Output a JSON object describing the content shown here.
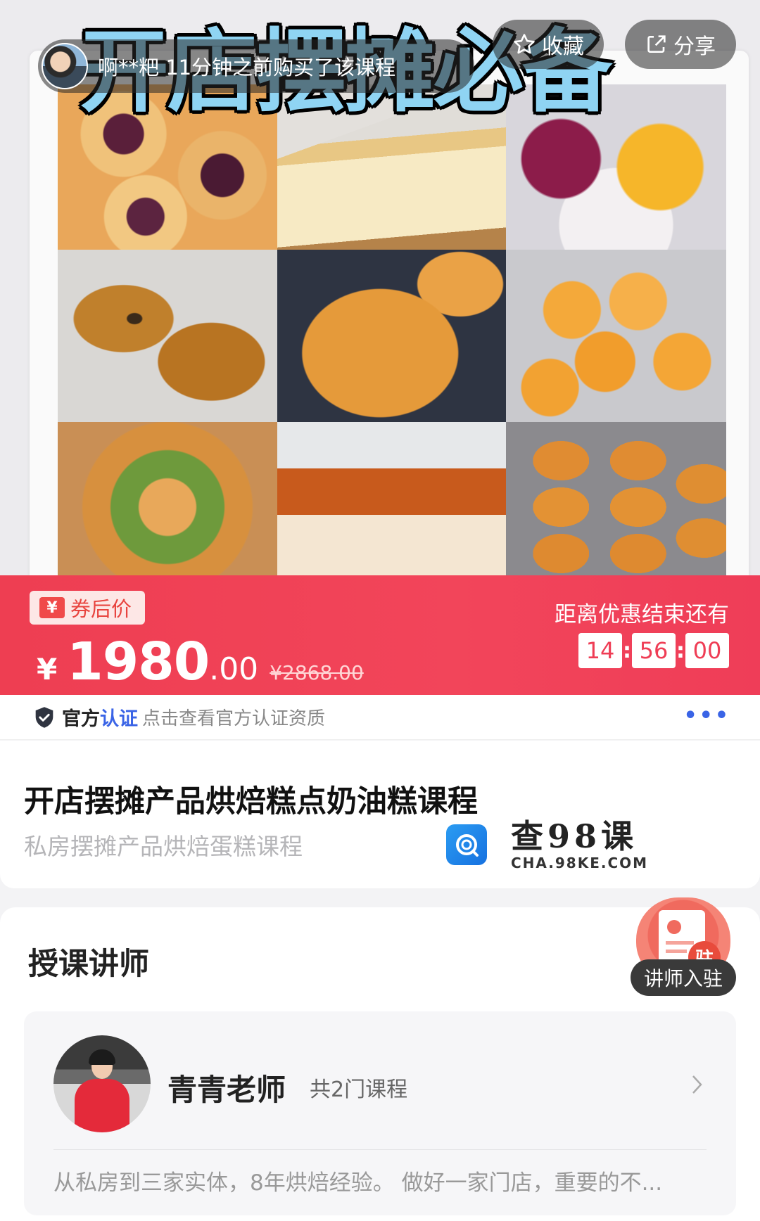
{
  "hero": {
    "title": "开店摆摊必备",
    "purchase_notice": "啊**粑 11分钟之前购买了该课程",
    "favorite_label": "收藏",
    "share_label": "分享"
  },
  "price": {
    "coupon_label": "券后价",
    "coupon_icon": "¥",
    "currency": "¥",
    "integer": "1980",
    "decimal": ".00",
    "original": "¥2868.00",
    "countdown_label": "距离优惠结束还有",
    "countdown": {
      "hours": "14",
      "minutes": "56",
      "seconds": "00"
    },
    "accent_color": "#ef3d55"
  },
  "verify": {
    "label_a": "官方",
    "label_b": "认证",
    "hint": "点击查看官方认证资质",
    "more": "•••",
    "accent_color": "#3a64e6"
  },
  "course": {
    "title": "开店摆摊产品烘焙糕点奶油糕课程",
    "subtitle": "私房摆摊产品烘焙蛋糕课程"
  },
  "watermark": {
    "main": "查98课",
    "url": "CHA.98KE.COM"
  },
  "teacher_section": {
    "title": "授课讲师",
    "join_label": "讲师入驻",
    "join_badge_char": "驻",
    "teacher": {
      "name": "青青老师",
      "course_count": "共2门课程",
      "description": "从私房到三家实体，8年烘焙经验。 做好一家门店，重要的不..."
    }
  },
  "icons": [
    "star-icon",
    "share-icon",
    "shield-check-icon",
    "more-dots-icon",
    "chevron-right-icon",
    "watermark-logo-icon"
  ]
}
